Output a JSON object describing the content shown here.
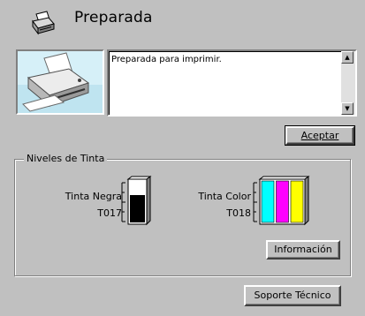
{
  "header": {
    "title": "Preparada",
    "icon": "printer-icon"
  },
  "status": {
    "message": "Preparada para imprimir."
  },
  "buttons": {
    "accept": "Aceptar",
    "info": "Información",
    "support": "Soporte Técnico"
  },
  "ink": {
    "group_label": "Niveles de Tinta",
    "black": {
      "name": "Tinta Negra",
      "code": "T017",
      "level": 0.65,
      "color": "#000000"
    },
    "color": {
      "name": "Tinta Color",
      "code": "T018",
      "levels": [
        {
          "name": "cyan",
          "color": "#00ffff",
          "level": 1.0
        },
        {
          "name": "magenta",
          "color": "#ff00ff",
          "level": 1.0
        },
        {
          "name": "yellow",
          "color": "#ffff00",
          "level": 1.0
        }
      ]
    }
  }
}
